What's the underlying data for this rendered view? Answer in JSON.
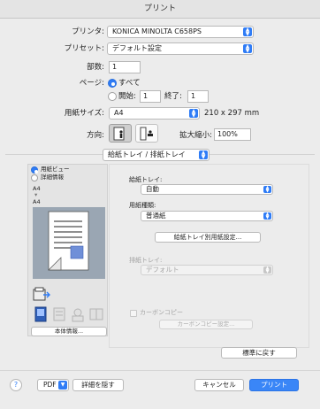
{
  "window": {
    "title": "プリント"
  },
  "printer": {
    "label": "プリンタ:",
    "value": "KONICA MINOLTA C658PS"
  },
  "preset": {
    "label": "プリセット:",
    "value": "デフォルト設定"
  },
  "copies": {
    "label": "部数:",
    "value": "1"
  },
  "pages": {
    "label": "ページ:",
    "all_label": "すべて",
    "from_label": "開始:",
    "from_value": "1",
    "to_label": "終了:",
    "to_value": "1",
    "selected": "all"
  },
  "paper": {
    "label": "用紙サイズ:",
    "value": "A4",
    "dims": "210 x 297 mm"
  },
  "orientation": {
    "label": "方向:",
    "selected": "portrait"
  },
  "scale": {
    "label": "拡大縮小:",
    "value": "100%"
  },
  "section": {
    "value": "給紙トレイ / 排紙トレイ"
  },
  "preview": {
    "view_label": "用紙ビュー",
    "detail_label": "詳細情報",
    "paper_tag1": "A4",
    "paper_tag2": "A4",
    "body_info_button": "本体情報..."
  },
  "tray": {
    "label": "給紙トレイ:",
    "value": "自動",
    "paper_type_label": "用紙種類:",
    "paper_type_value": "普通紙",
    "tray_settings_button": "給紙トレイ別用紙設定..."
  },
  "output": {
    "label": "排紙トレイ:",
    "value": "デフォルト"
  },
  "carbon": {
    "label": "カーボンコピー",
    "button": "カーボンコピー設定..."
  },
  "defaults_button": "標準に戻す",
  "footer": {
    "help": "?",
    "pdf": "PDF",
    "hide_details": "詳細を隠す",
    "cancel": "キャンセル",
    "print": "プリント"
  },
  "colors": {
    "accent": "#2f7cf6",
    "background": "#ececec"
  }
}
